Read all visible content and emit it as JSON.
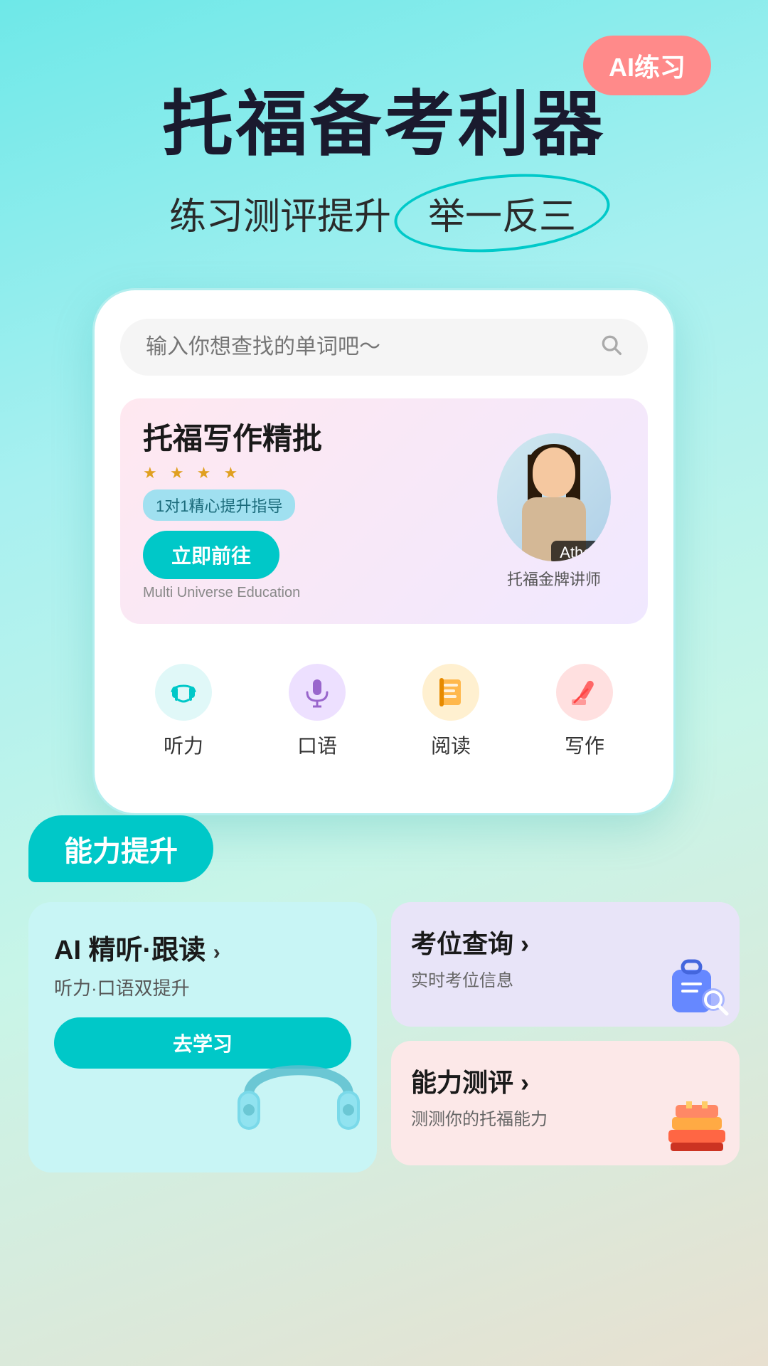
{
  "aiBadge": "AI练习",
  "heroTitle": "托福备考利器",
  "heroSubtitleMain": "练习测评提升",
  "heroSubtitleHighlight": "举一反三",
  "search": {
    "placeholder": "输入你想查找的单词吧～"
  },
  "banner": {
    "title": "托福写作精批",
    "stars": "★ ★ ★ ★",
    "tag": "1对1精心提升指导",
    "buttonLabel": "立即前往",
    "company": "Multi Universe Education",
    "teacherName": "Athena",
    "teacherLabel": "托福金牌讲师"
  },
  "features": [
    {
      "icon": "🎧",
      "label": "听力",
      "colorClass": "hearing"
    },
    {
      "icon": "🎙️",
      "label": "口语",
      "colorClass": "speaking"
    },
    {
      "icon": "📖",
      "label": "阅读",
      "colorClass": "reading"
    },
    {
      "icon": "✏️",
      "label": "写作",
      "colorClass": "writing"
    }
  ],
  "abilityBadge": "能力提升",
  "cards": {
    "main": {
      "title": "AI 精听·跟读",
      "arrow": "›",
      "subtitle": "听力·口语双提升",
      "learnBtn": "去学习"
    },
    "exam": {
      "title": "考位查询",
      "arrow": "›",
      "subtitle": "实时考位信息"
    },
    "ability": {
      "title": "能力测评",
      "arrow": "›",
      "subtitle": "测测你的托福能力"
    }
  }
}
